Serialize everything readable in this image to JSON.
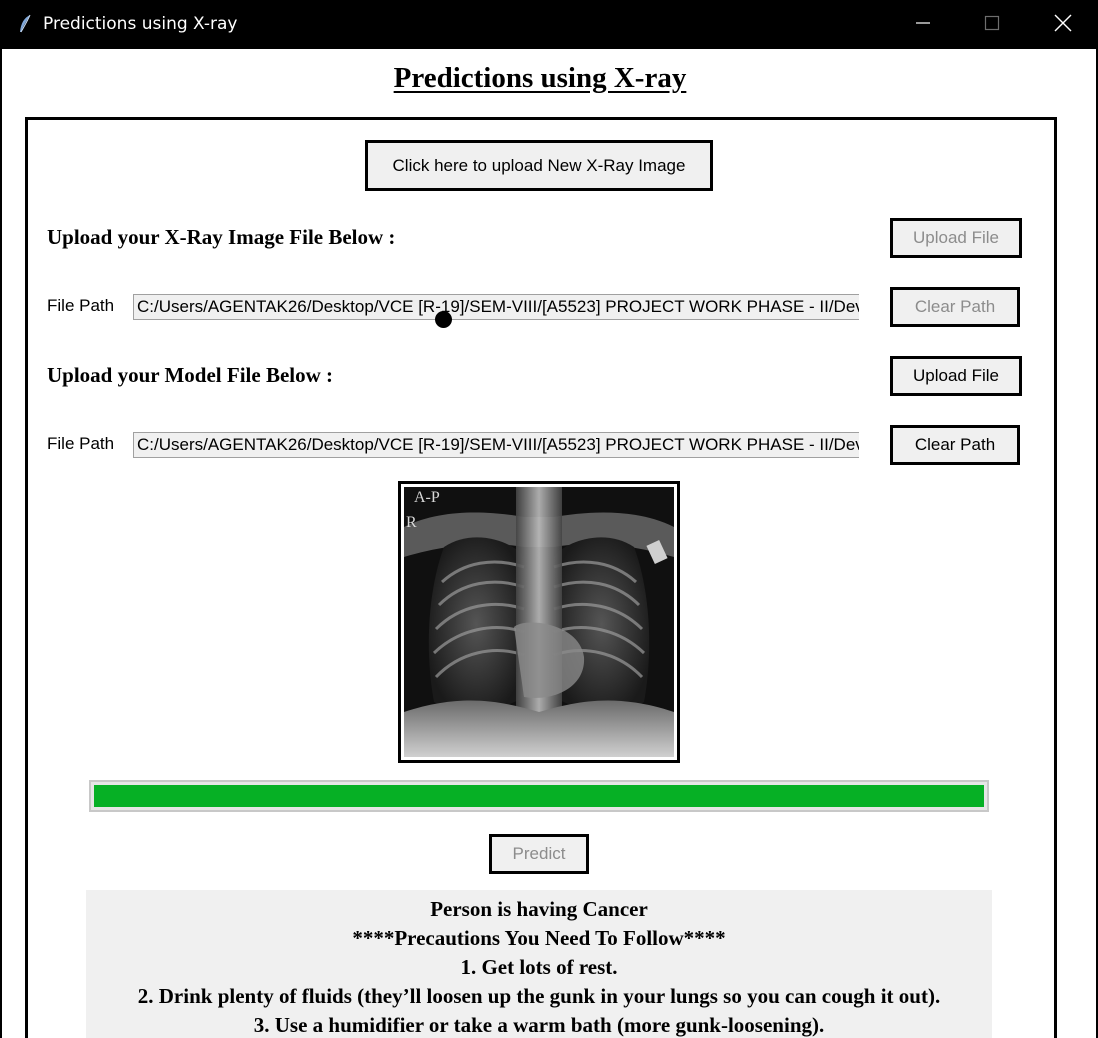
{
  "window": {
    "title": "Predictions using X-ray",
    "app_icon": "feather-icon",
    "controls": [
      "minimize-icon",
      "maximize-icon",
      "close-icon"
    ]
  },
  "heading": "Predictions using X-ray",
  "upload_new_button": "Click here to upload New X-Ray Image",
  "xray_section": {
    "label": "Upload your X-Ray Image File Below :",
    "upload_button": "Upload File",
    "upload_button_enabled": false,
    "path_label": "File Path",
    "path_value": "C:/Users/AGENTAK26/Desktop/VCE [R-19]/SEM-VIII/[A5523] PROJECT WORK PHASE - II/Dev",
    "clear_button": "Clear Path",
    "clear_button_enabled": false
  },
  "model_section": {
    "label": "Upload your Model File Below :",
    "upload_button": "Upload File",
    "upload_button_enabled": true,
    "path_label": "File Path",
    "path_value": "C:/Users/AGENTAK26/Desktop/VCE [R-19]/SEM-VIII/[A5523] PROJECT WORK PHASE - II/Dev",
    "clear_button": "Clear Path",
    "clear_button_enabled": true
  },
  "xray_image_overlay": {
    "line1": "A-P",
    "line2": "R"
  },
  "progress": {
    "value_percent": 100,
    "color": "#06b025"
  },
  "predict_button": {
    "label": "Predict",
    "enabled": false
  },
  "result": {
    "lines": [
      "Person is having Cancer",
      "****Precautions You Need To Follow****",
      "1. Get lots of rest.",
      "2. Drink plenty of fluids (they’ll loosen up the gunk in your lungs so you can cough it out).",
      "3. Use a humidifier or take a warm bath (more gunk-loosening)."
    ]
  }
}
